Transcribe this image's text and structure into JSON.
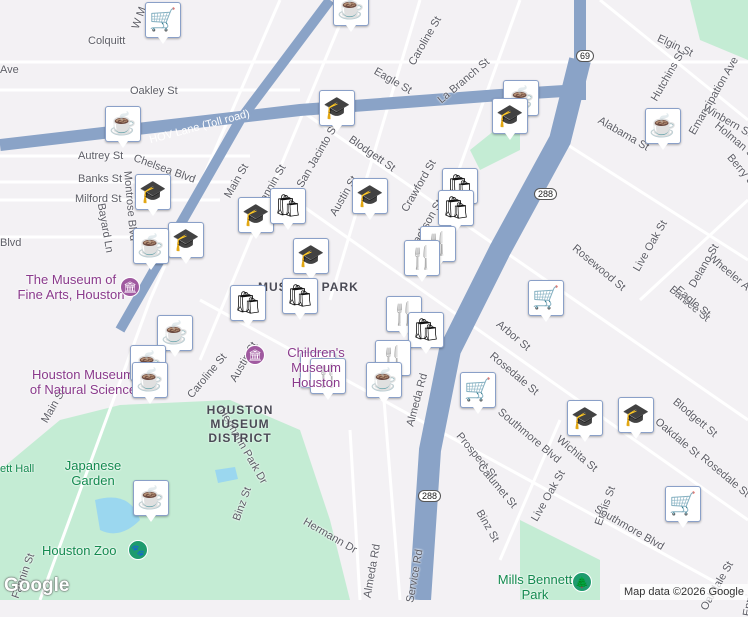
{
  "map": {
    "streets": [
      "W M",
      "Oakley St",
      "Colquitt",
      "Autrey St",
      "Banks St",
      "Milford St",
      "Chelsea Blvd",
      "Montrose Blvd",
      "Bayard Ln",
      "Main St",
      "Fannin St",
      "San Jacinto St",
      "Caroline St",
      "Eagle St",
      "La Branch St",
      "Blodgett St",
      "Austin St",
      "Crawford St",
      "Jackson St",
      "Elgin St",
      "Hutchins St",
      "Emancipation Ave",
      "Alabama St",
      "Winbern St",
      "Holman St",
      "Berry St",
      "Live Oak St",
      "Wheeler Ave",
      "Rosewood St",
      "Delano St",
      "Barbee St",
      "Eagle St",
      "Arbor St",
      "Rosedale St",
      "Blodgett St",
      "Southmore Blvd",
      "Wichita St",
      "Oakdale St",
      "Prospect St",
      "Calumet St",
      "Binz St",
      "Ennis St",
      "Almeda Rd",
      "Hermann Dr",
      "Hermann Park Dr",
      "Binz St",
      "Main St",
      "Southmore Blvd",
      "Rosedale St",
      "Oakdale St",
      "Service Rd",
      "Almeda Rd",
      "Live Oak St",
      "Ennis St",
      "Fannin St",
      "Caroline St",
      "Austin St",
      "Ave",
      "Blvd",
      "HOV Lane (Toll road)"
    ],
    "highway_shields": [
      "69",
      "288",
      "288"
    ],
    "pois": {
      "mfah": "The Museum of Fine Arts, Houston",
      "hmns": "Houston Museum of Natural Science",
      "childrens": "Children's Museum Houston",
      "district": "HOUSTON MUSEUM DISTRICT",
      "park_area": "MUSEUM PARK",
      "japanese_garden": "Japanese Garden",
      "zoo": "Houston Zoo",
      "mills": "Mills Bennett Park",
      "hall": "Miller Outdoor Theatre Hall",
      "hall_visible": "ett Hall"
    },
    "marker_types": [
      "grocery",
      "cafe",
      "school",
      "shopping",
      "restaurant"
    ]
  },
  "branding": {
    "logo": "Google",
    "attribution": "Map data ©2026 Google"
  },
  "colors": {
    "park": "#c4ecd4",
    "highway": "#8aa3c7",
    "road": "#ffffff",
    "poi": "#8a3a8c"
  }
}
